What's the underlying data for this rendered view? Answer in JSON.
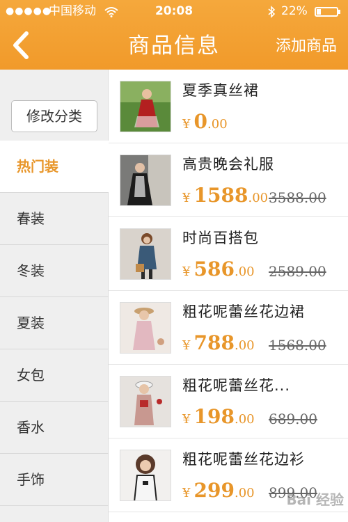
{
  "status_bar": {
    "signal": "●●●●●",
    "carrier": "中国移动",
    "time": "20:08",
    "battery_pct": "22%",
    "battery_level": 0.22
  },
  "nav": {
    "title": "商品信息",
    "add_label": "添加商品"
  },
  "sidebar": {
    "edit_label": "修改分类",
    "items": [
      {
        "label": "热门装"
      },
      {
        "label": "春装"
      },
      {
        "label": "冬装"
      },
      {
        "label": "夏装"
      },
      {
        "label": "女包"
      },
      {
        "label": "香水"
      },
      {
        "label": "手饰"
      }
    ]
  },
  "products": [
    {
      "name": "夏季真丝裙",
      "currency": "¥",
      "price_int": "0",
      "price_dec": ".00",
      "old_price": ""
    },
    {
      "name": "高贵晚会礼服",
      "currency": "¥",
      "price_int": "1588",
      "price_dec": ".00",
      "old_price": "3588.00"
    },
    {
      "name": "时尚百搭包",
      "currency": "¥",
      "price_int": "586",
      "price_dec": ".00",
      "old_price": "2589.00"
    },
    {
      "name": "粗花呢蕾丝花边裙",
      "currency": "¥",
      "price_int": "788",
      "price_dec": ".00",
      "old_price": "1568.00"
    },
    {
      "name": "粗花呢蕾丝花...",
      "currency": "¥",
      "price_int": "198",
      "price_dec": ".00",
      "old_price": "689.00"
    },
    {
      "name": "粗花呢蕾丝花边衫",
      "currency": "¥",
      "price_int": "299",
      "price_dec": ".00",
      "old_price": "899.00"
    }
  ],
  "watermark": "Bai 经验",
  "colors": {
    "accent": "#f19a2a",
    "price": "#e8962a"
  }
}
